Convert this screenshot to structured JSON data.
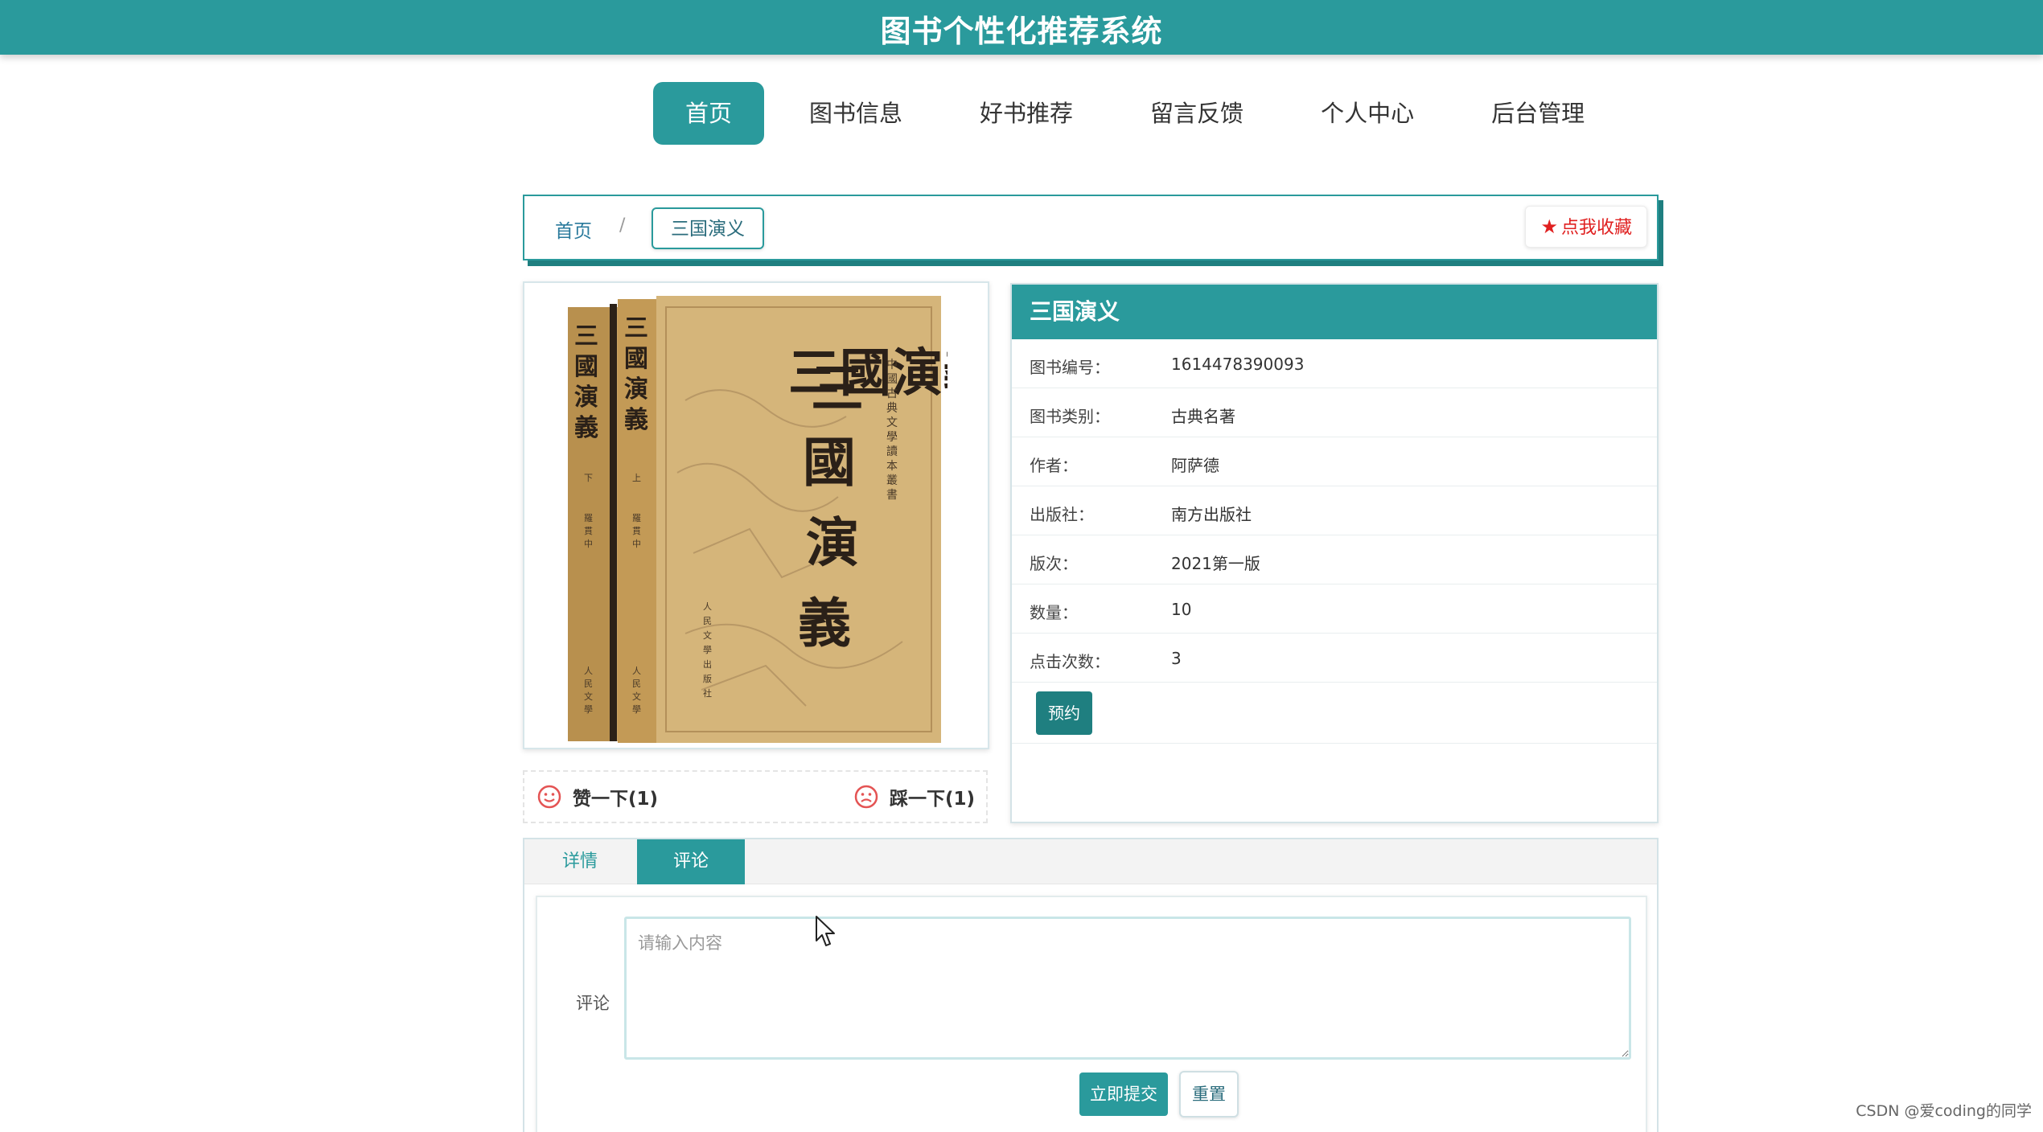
{
  "app": {
    "title": "图书个性化推荐系统"
  },
  "nav": [
    {
      "label": "首页",
      "active": true
    },
    {
      "label": "图书信息"
    },
    {
      "label": "好书推荐"
    },
    {
      "label": "留言反馈"
    },
    {
      "label": "个人中心"
    },
    {
      "label": "后台管理"
    }
  ],
  "breadcrumb": {
    "home": "首页",
    "separator": "/",
    "current": "三国演义"
  },
  "favorite": {
    "label": "点我收藏",
    "icon": "star-icon"
  },
  "cover": {
    "spine_text": "三國演義",
    "title_text": "三國演義",
    "series_text": "中國古典文學讀本叢書"
  },
  "votes": {
    "up": {
      "label": "赞一下(1)",
      "icon": "smile-icon"
    },
    "down": {
      "label": "踩一下(1)",
      "icon": "frown-icon"
    }
  },
  "book": {
    "title": "三国演义",
    "fields": [
      {
        "label": "图书编号：",
        "value": "1614478390093"
      },
      {
        "label": "图书类别：",
        "value": "古典名著"
      },
      {
        "label": "作者：",
        "value": "阿萨德"
      },
      {
        "label": "出版社：",
        "value": "南方出版社"
      },
      {
        "label": "版次：",
        "value": "2021第一版"
      },
      {
        "label": "数量：",
        "value": "10"
      },
      {
        "label": "点击次数：",
        "value": "3"
      }
    ],
    "reserve_label": "预约"
  },
  "tabs": {
    "detail": "详情",
    "comment": "评论",
    "active": "comment"
  },
  "comment_form": {
    "label": "评论",
    "placeholder": "请输入内容",
    "submit": "立即提交",
    "reset": "重置"
  },
  "watermark": "CSDN @爱coding的同学",
  "colors": {
    "primary": "#2a9a9c",
    "primary_dark": "#1f7f80",
    "favorite": "#e02020"
  }
}
